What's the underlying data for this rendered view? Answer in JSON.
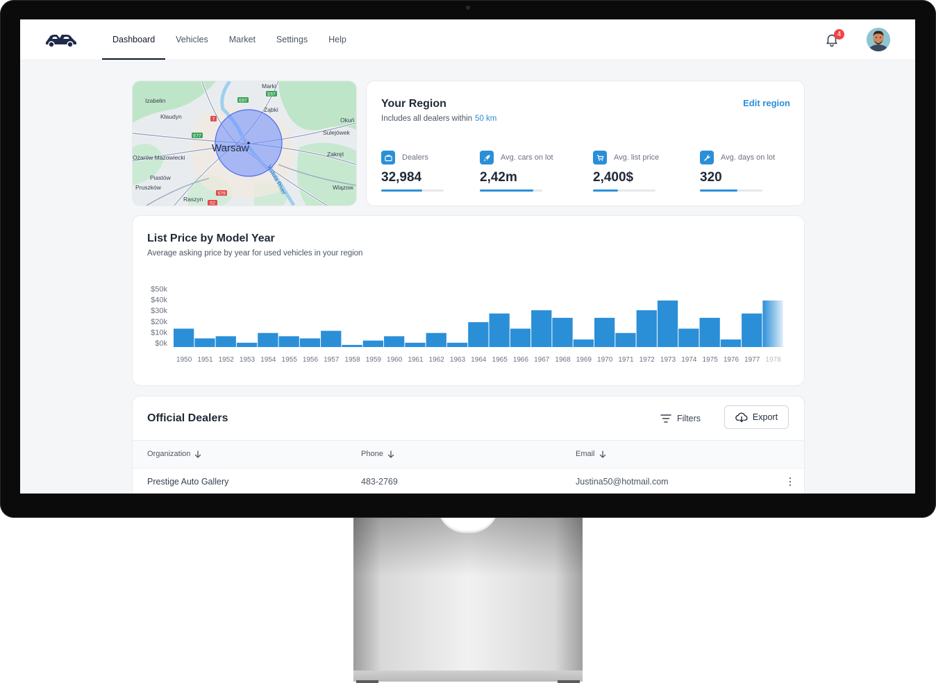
{
  "nav": {
    "tabs": [
      "Dashboard",
      "Vehicles",
      "Market",
      "Settings",
      "Help"
    ],
    "active_tab": 0,
    "notification_count": "4",
    "brand_color": "#1e2a4a"
  },
  "map": {
    "city_label": "Warsaw",
    "river_label": "Vistula River",
    "places": [
      "Marki",
      "Izabelin",
      "Ząbki",
      "Kłaudyn",
      "Okuń",
      "Sulejówek",
      "Ożarów Mazowiecki",
      "Zakręt",
      "Piastów",
      "Pruszków",
      "Wiązow",
      "Raszyn"
    ],
    "road_badges": [
      "E67",
      "E67",
      "7",
      "E77",
      "S79",
      "S2"
    ]
  },
  "region": {
    "title": "Your Region",
    "subtitle": "Includes all dealers within",
    "radius": "50 km",
    "edit_label": "Edit region",
    "accent": "#2b8fd8",
    "stats": [
      {
        "label": "Dealers",
        "value": "32,984",
        "icon": "briefcase-icon",
        "progress": 0.65
      },
      {
        "label": "Avg. cars on lot",
        "value": "2,42m",
        "icon": "rocket-icon",
        "progress": 0.85
      },
      {
        "label": "Avg. list price",
        "value": "2,400$",
        "icon": "cart-icon",
        "progress": 0.4
      },
      {
        "label": "Avg. days on lot",
        "value": "320",
        "icon": "wrench-icon",
        "progress": 0.6
      }
    ]
  },
  "chart": {
    "title": "List Price by Model Year",
    "subtitle": "Average asking price by year for used vehicles in your region"
  },
  "chart_data": {
    "type": "bar",
    "categories": [
      "1950",
      "1951",
      "1952",
      "1953",
      "1954",
      "1955",
      "1956",
      "1957",
      "1958",
      "1959",
      "1960",
      "1961",
      "1962",
      "1963",
      "1964",
      "1965",
      "1966",
      "1967",
      "1968",
      "1969",
      "1970",
      "1971",
      "1972",
      "1973",
      "1974",
      "1975",
      "1976",
      "1977",
      "1978"
    ],
    "values": [
      17,
      8,
      10,
      4,
      13,
      10,
      8,
      15,
      2,
      6,
      10,
      4,
      13,
      4,
      23,
      31,
      17,
      34,
      27,
      7,
      27,
      13,
      34,
      43,
      17,
      27,
      7,
      31,
      43
    ],
    "y_tick_labels": [
      "$50k",
      "$40k",
      "$30k",
      "$20k",
      "$10k",
      "$0k"
    ],
    "ylim": [
      0,
      50
    ],
    "grid": false,
    "legend": "none",
    "bar_color": "#2b8fd8",
    "last_bar_fades": true
  },
  "dealers": {
    "title": "Official Dealers",
    "filters_label": "Filters",
    "export_label": "Export",
    "columns": [
      "Organization",
      "Phone",
      "Email"
    ],
    "rows": [
      {
        "organization": "Prestige Auto Gallery",
        "phone": "483-2769",
        "email": "Justina50@hotmail.com"
      }
    ]
  }
}
